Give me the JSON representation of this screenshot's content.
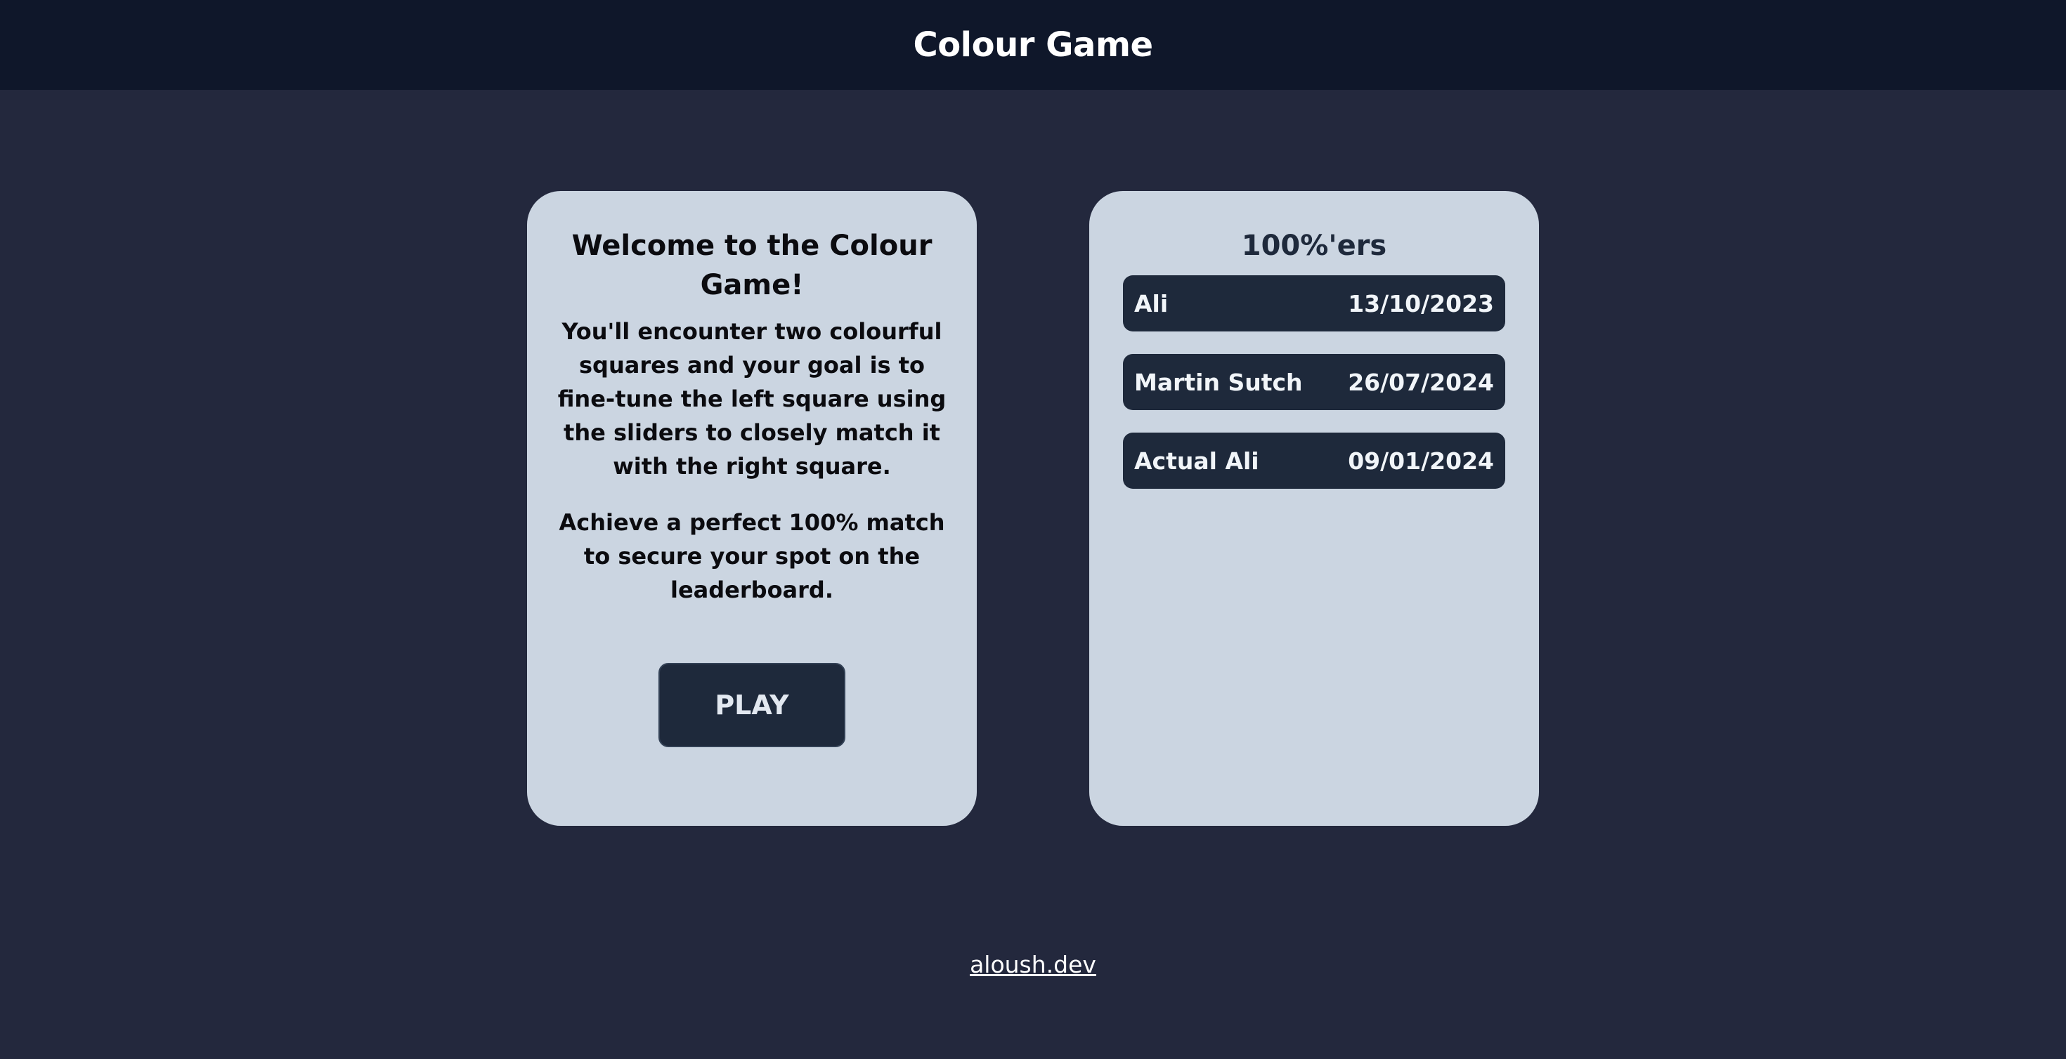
{
  "header": {
    "title": "Colour Game"
  },
  "welcome": {
    "title": "Welcome to the Colour Game!",
    "paragraphs": [
      "You'll encounter two colourful squares and your goal is to fine-tune the left square using the sliders to closely match it with the right square.",
      "Achieve a perfect 100% match to secure your spot on the leaderboard."
    ],
    "play_label": "PLAY"
  },
  "leaderboard": {
    "title": "100%'ers",
    "entries": [
      {
        "name": "Ali",
        "date": "13/10/2023"
      },
      {
        "name": "Martin Sutch",
        "date": "26/07/2024"
      },
      {
        "name": "Actual Ali",
        "date": "09/01/2024"
      }
    ]
  },
  "footer": {
    "link_text": "aloush.dev"
  },
  "colors": {
    "page_bg": "#23283d",
    "header_bg": "#0f172a",
    "card_bg": "#cbd5e1",
    "button_bg": "#1e293b"
  }
}
